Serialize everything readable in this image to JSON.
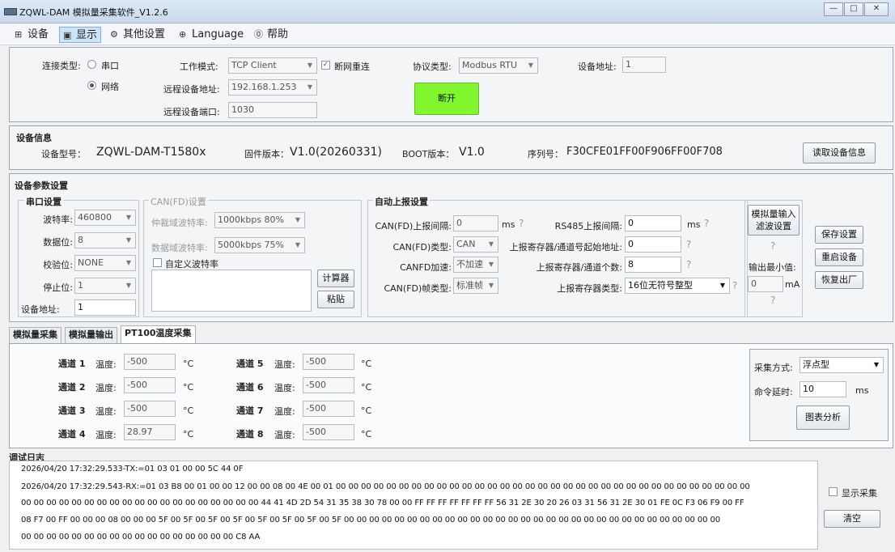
{
  "window": {
    "title": "ZQWL-DAM 模拟量采集软件_V1.2.6",
    "min_label": "—",
    "max_label": "□",
    "close_label": "✕"
  },
  "menu": [
    {
      "icon": "grid-icon",
      "glyph": "⊞",
      "label": "设备"
    },
    {
      "icon": "monitor-icon",
      "glyph": "▣",
      "label": "显示"
    },
    {
      "icon": "gear-icon",
      "glyph": "⚙",
      "label": "其他设置"
    },
    {
      "icon": "globe-icon",
      "glyph": "⊕",
      "label": "Language"
    },
    {
      "icon": "help-icon",
      "glyph": "⓪",
      "label": "帮助"
    }
  ],
  "connection": {
    "type_label": "连接类型:",
    "serial_label": "串口",
    "network_label": "网络",
    "selected": "网络",
    "work_mode_label": "工作模式:",
    "work_mode_value": "TCP Client",
    "reconnect_label": "断网重连",
    "reconnect_checked": true,
    "remote_addr_label": "远程设备地址:",
    "remote_addr_value": "192.168.1.253",
    "remote_port_label": "远程设备端口:",
    "remote_port_value": "1030",
    "protocol_label": "协议类型:",
    "protocol_value": "Modbus RTU",
    "device_addr_label": "设备地址:",
    "device_addr_value": "1",
    "disconnect_label": "断开",
    "accent": "#7ff72c"
  },
  "device_info": {
    "title": "设备信息",
    "model_label": "设备型号：",
    "model_value": "ZQWL-DAM-T1580x",
    "fw_label": "固件版本：",
    "fw_value": "V1.0(20260331)",
    "boot_label": "BOOT版本：",
    "boot_value": "V1.0",
    "serial_label": "序列号：",
    "serial_value": "F30CFE01FF00F906FF00F708",
    "read_button": "读取设备信息"
  },
  "params": {
    "title": "设备参数设置",
    "serial": {
      "title": "串口设置",
      "baud_label": "波特率:",
      "baud_value": "460800",
      "data_label": "数据位:",
      "data_value": "8",
      "parity_label": "校验位:",
      "parity_value": "NONE",
      "stop_label": "停止位:",
      "stop_value": "1",
      "addr_label": "设备地址:",
      "addr_value": "1"
    },
    "can": {
      "title": "CAN(FD)设置",
      "arb_label": "仲裁域波特率:",
      "arb_value": "1000kbps 80%",
      "data_label": "数据域波特率:",
      "data_value": "5000kbps 75%",
      "custom_label": "自定义波特率",
      "calc_button": "计算器",
      "paste_button": "粘贴"
    },
    "auto_report": {
      "title": "自动上报设置",
      "can_interval_label": "CAN(FD)上报间隔:",
      "can_interval_value": "0",
      "ms1": "ms",
      "rs485_interval_label": "RS485上报间隔:",
      "rs485_interval_value": "0",
      "ms2": "ms",
      "can_type_label": "CAN(FD)类型:",
      "can_type_value": "CAN",
      "reg_start_label": "上报寄存器/通道号起始地址:",
      "reg_start_value": "0",
      "canfd_accel_label": "CANFD加速:",
      "canfd_accel_value": "不加速",
      "reg_count_label": "上报寄存器/通道个数:",
      "reg_count_value": "8",
      "frame_type_label": "CAN(FD)帧类型:",
      "frame_type_value": "标准帧",
      "reg_type_label": "上报寄存器类型:",
      "reg_type_value": "16位无符号整型"
    },
    "filter": {
      "button": "模拟量输入\n滤波设置",
      "min_out_label": "输出最小值:",
      "min_out_value": "0",
      "unit": "mA"
    },
    "save_button": "保存设置",
    "restart_button": "重启设备",
    "factory_button": "恢复出厂"
  },
  "tabs": [
    {
      "label": "模拟量采集",
      "active": false
    },
    {
      "label": "模拟量输出",
      "active": false
    },
    {
      "label": "PT100温度采集",
      "active": true
    }
  ],
  "pt100": {
    "channel_prefix": "通道",
    "temp_label": "温度:",
    "unit": "°C",
    "channels": [
      {
        "num": "1",
        "value": "-500"
      },
      {
        "num": "2",
        "value": "-500"
      },
      {
        "num": "3",
        "value": "-500"
      },
      {
        "num": "4",
        "value": "28.97"
      },
      {
        "num": "5",
        "value": "-500"
      },
      {
        "num": "6",
        "value": "-500"
      },
      {
        "num": "7",
        "value": "-500"
      },
      {
        "num": "8",
        "value": "-500"
      }
    ],
    "collect_mode_label": "采集方式:",
    "collect_mode_value": "浮点型",
    "cmd_delay_label": "命令延时:",
    "cmd_delay_value": "10",
    "cmd_delay_unit": "ms",
    "chart_button": "图表分析"
  },
  "log": {
    "title": "调试日志",
    "lines": [
      "2026/04/20 17:32:29.533-TX:=01 03 01 00 00 5C 44 0F",
      "2026/04/20 17:32:29.543-RX:=01 03 B8 00 01 00 00 12 00 00 08 00 4E 00 01 00 00 00 00 00 00 00 00 00 00 00 00 00 00 00 00 00 00 00 00 00 00 00 00 00 00 00 00 00 00 00 00 00",
      "00 00 00 00 00 00 00 00 00 00 00 00 00 00 00 00 00 00 00 44 41 4D 2D 54 31 35 38 30 78 00 00 FF FF FF FF FF FF FF 56 31 2E 30 20 26 03 31 56 31 2E 30 01 FE 0C F3 06 F9 00 FF",
      "08 F7 00 FF 00 00 00 08 00 00 00 5F 00 5F 00 5F 00 5F 00 5F 00 5F 00 5F 00 5F 00 00 00 00 00 00 00 00 00 00 00 00 00 00 00 00 00 00 00 00 00 00 00 00 00 00 00 00 00 00",
      "00 00 00 00 00 00 00 00 00 00 00 00 00 00 00 00 00 C8 AA"
    ],
    "show_collect_label": "显示采集",
    "clear_button": "清空"
  }
}
